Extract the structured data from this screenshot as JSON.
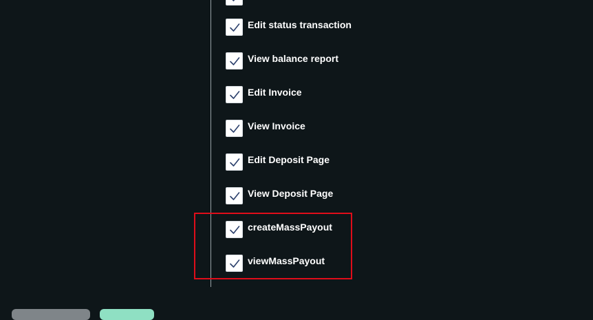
{
  "permissions": {
    "items": [
      {
        "label": "",
        "checked": true,
        "icon": "checkmark-icon"
      },
      {
        "label": "Edit status transaction",
        "checked": true,
        "icon": "checkmark-icon"
      },
      {
        "label": "View balance report",
        "checked": true,
        "icon": "checkmark-icon"
      },
      {
        "label": "Edit Invoice",
        "checked": true,
        "icon": "checkmark-icon"
      },
      {
        "label": "View Invoice",
        "checked": true,
        "icon": "checkmark-icon"
      },
      {
        "label": "Edit Deposit Page",
        "checked": true,
        "icon": "checkmark-icon"
      },
      {
        "label": "View Deposit Page",
        "checked": true,
        "icon": "checkmark-icon"
      },
      {
        "label": "createMassPayout",
        "checked": true,
        "icon": "checkmark-icon"
      },
      {
        "label": "viewMassPayout",
        "checked": true,
        "icon": "checkmark-icon"
      }
    ]
  },
  "footer": {
    "secondary_button_label": "",
    "primary_button_label": ""
  },
  "colors": {
    "background": "#0e1619",
    "highlight_border": "#e00d1a",
    "checkmark": "#2a3f6b",
    "primary_button": "#8fe0c3",
    "secondary_button": "#7f8589"
  }
}
